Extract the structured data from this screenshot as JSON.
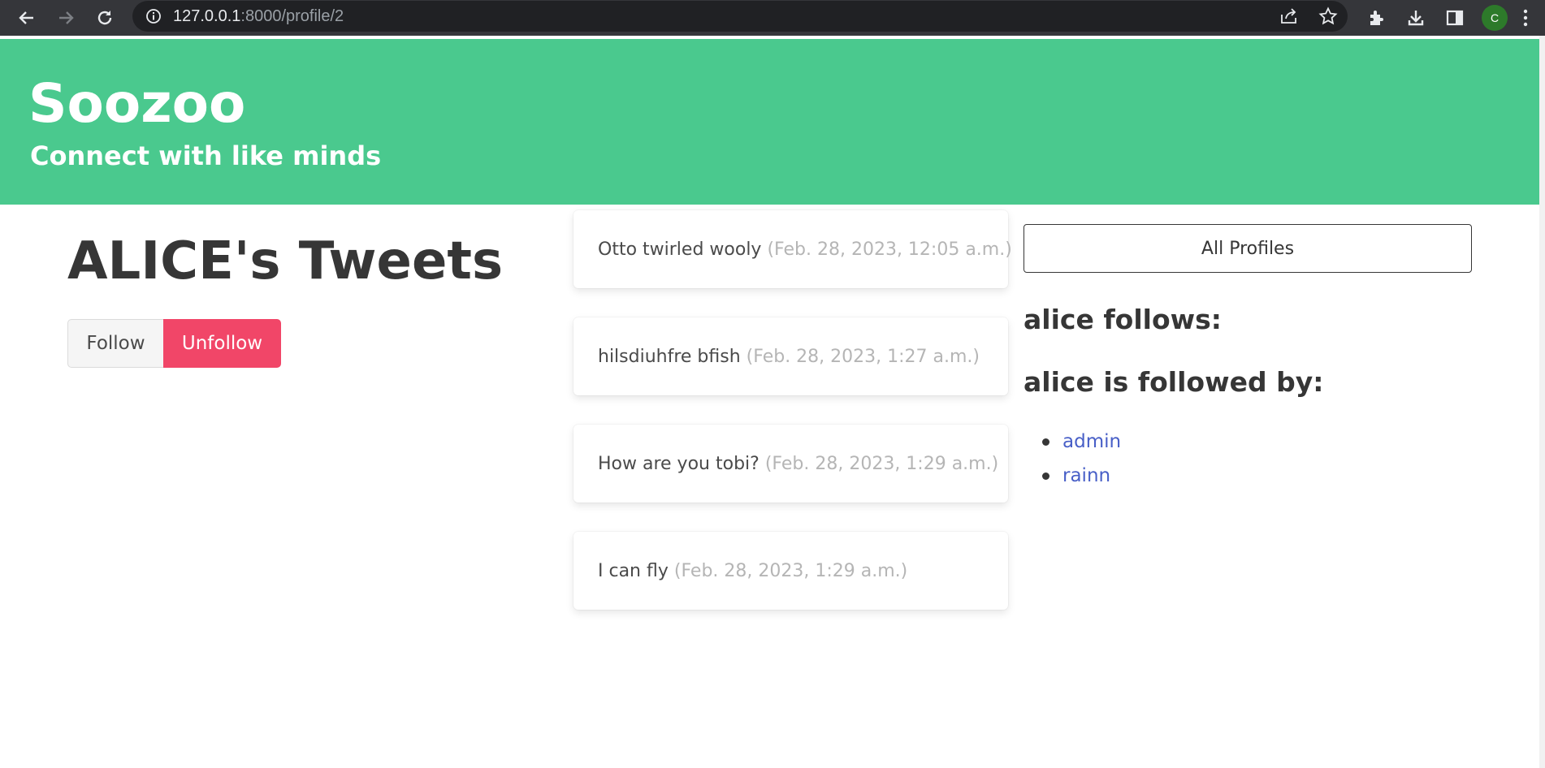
{
  "browser": {
    "url_host": "127.0.0.1",
    "url_rest": ":8000/profile/2",
    "profile_initial": "C",
    "icons": [
      "back-arrow-icon",
      "forward-arrow-icon",
      "reload-icon",
      "info-icon",
      "share-icon",
      "star-icon",
      "extensions-icon",
      "download-icon",
      "side-panel-icon",
      "kebab-menu-icon"
    ]
  },
  "hero": {
    "title": "Soozoo",
    "subtitle": "Connect with like minds",
    "background": "#4ac98e"
  },
  "profile": {
    "heading": "ALICE's Tweets",
    "follow_label": "Follow",
    "unfollow_label": "Unfollow",
    "unfollow_color": "#f14668"
  },
  "tweets": [
    {
      "text": "Otto twirled wooly",
      "date": "(Feb. 28, 2023, 12:05 a.m.)"
    },
    {
      "text": "hilsdiuhfre bfish",
      "date": "(Feb. 28, 2023, 1:27 a.m.)"
    },
    {
      "text": "How are you tobi?",
      "date": "(Feb. 28, 2023, 1:29 a.m.)"
    },
    {
      "text": "I can fly",
      "date": "(Feb. 28, 2023, 1:29 a.m.)"
    }
  ],
  "sidebar": {
    "all_profiles_label": "All Profiles",
    "follows_heading": "alice follows:",
    "followed_by_heading": "alice is followed by:",
    "followers": [
      "admin",
      "rainn"
    ],
    "link_color": "#485fc7"
  }
}
